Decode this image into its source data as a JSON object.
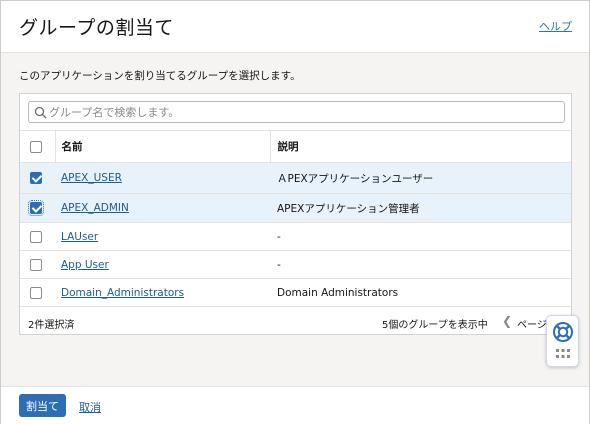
{
  "dialog": {
    "title": "グループの割当て",
    "help_label": "ヘルプ"
  },
  "body": {
    "description": "このアプリケーションを割り当てるグループを選択します。"
  },
  "search": {
    "placeholder": "グループ名で検索します。",
    "value": ""
  },
  "table": {
    "columns": {
      "name": "名前",
      "description": "説明"
    },
    "rows": [
      {
        "name": "APEX_USER",
        "description": "ＡPEXアプリケーションユーザー",
        "selected": true
      },
      {
        "name": "APEX_ADMIN",
        "description": "APEXアプリケーション管理者",
        "selected": true
      },
      {
        "name": "LAUser",
        "description": "-",
        "selected": false
      },
      {
        "name": "App User",
        "description": "-",
        "selected": false
      },
      {
        "name": "Domain_Administrators",
        "description": "Domain Administrators",
        "selected": false
      }
    ]
  },
  "pagination": {
    "selected_count": "2件選択済",
    "showing": "5個のグループを表示中",
    "page_label": "ページ"
  },
  "actions": {
    "assign_label": "割当て",
    "cancel_label": "取消"
  },
  "colors": {
    "accent": "#2d6db4",
    "link": "#1b5e8c",
    "selected_row": "#e8f2fa"
  }
}
